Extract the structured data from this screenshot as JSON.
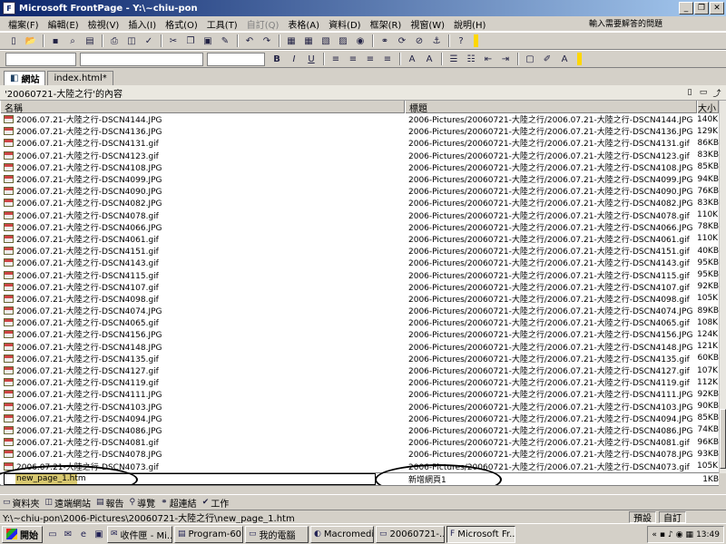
{
  "window": {
    "title": "Microsoft FrontPage - Y:\\~chiu-pon"
  },
  "menu": {
    "items": [
      "檔案(F)",
      "編輯(E)",
      "檢視(V)",
      "插入(I)",
      "格式(O)",
      "工具(T)",
      "自訂(Q)",
      "表格(A)",
      "資料(D)",
      "框架(R)",
      "視窗(W)",
      "說明(H)"
    ],
    "help_placeholder": "輸入需要解答的問題"
  },
  "tabs": [
    {
      "label": "網站"
    },
    {
      "label": "index.html*"
    }
  ],
  "folder": {
    "caption": "'20060721-大陸之行'的內容"
  },
  "columns": {
    "name": "名稱",
    "title": "標題",
    "size": "大小"
  },
  "files": [
    {
      "name": "2006.07.21-大陸之行-DSCN4144.JPG",
      "title": "2006-Pictures/20060721-大陸之行/2006.07.21-大陸之行-DSCN4144.JPG",
      "size": "140KB"
    },
    {
      "name": "2006.07.21-大陸之行-DSCN4136.JPG",
      "title": "2006-Pictures/20060721-大陸之行/2006.07.21-大陸之行-DSCN4136.JPG",
      "size": "129KB"
    },
    {
      "name": "2006.07.21-大陸之行-DSCN4131.gif",
      "title": "2006-Pictures/20060721-大陸之行/2006.07.21-大陸之行-DSCN4131.gif",
      "size": "86KB"
    },
    {
      "name": "2006.07.21-大陸之行-DSCN4123.gif",
      "title": "2006-Pictures/20060721-大陸之行/2006.07.21-大陸之行-DSCN4123.gif",
      "size": "83KB"
    },
    {
      "name": "2006.07.21-大陸之行-DSCN4108.JPG",
      "title": "2006-Pictures/20060721-大陸之行/2006.07.21-大陸之行-DSCN4108.JPG",
      "size": "85KB"
    },
    {
      "name": "2006.07.21-大陸之行-DSCN4099.JPG",
      "title": "2006-Pictures/20060721-大陸之行/2006.07.21-大陸之行-DSCN4099.JPG",
      "size": "94KB"
    },
    {
      "name": "2006.07.21-大陸之行-DSCN4090.JPG",
      "title": "2006-Pictures/20060721-大陸之行/2006.07.21-大陸之行-DSCN4090.JPG",
      "size": "76KB"
    },
    {
      "name": "2006.07.21-大陸之行-DSCN4082.JPG",
      "title": "2006-Pictures/20060721-大陸之行/2006.07.21-大陸之行-DSCN4082.JPG",
      "size": "83KB"
    },
    {
      "name": "2006.07.21-大陸之行-DSCN4078.gif",
      "title": "2006-Pictures/20060721-大陸之行/2006.07.21-大陸之行-DSCN4078.gif",
      "size": "110KB"
    },
    {
      "name": "2006.07.21-大陸之行-DSCN4066.JPG",
      "title": "2006-Pictures/20060721-大陸之行/2006.07.21-大陸之行-DSCN4066.JPG",
      "size": "78KB"
    },
    {
      "name": "2006.07.21-大陸之行-DSCN4061.gif",
      "title": "2006-Pictures/20060721-大陸之行/2006.07.21-大陸之行-DSCN4061.gif",
      "size": "110KB"
    },
    {
      "name": "2006.07.21-大陸之行-DSCN4151.gif",
      "title": "2006-Pictures/20060721-大陸之行/2006.07.21-大陸之行-DSCN4151.gif",
      "size": "40KB"
    },
    {
      "name": "2006.07.21-大陸之行-DSCN4143.gif",
      "title": "2006-Pictures/20060721-大陸之行/2006.07.21-大陸之行-DSCN4143.gif",
      "size": "95KB"
    },
    {
      "name": "2006.07.21-大陸之行-DSCN4115.gif",
      "title": "2006-Pictures/20060721-大陸之行/2006.07.21-大陸之行-DSCN4115.gif",
      "size": "95KB"
    },
    {
      "name": "2006.07.21-大陸之行-DSCN4107.gif",
      "title": "2006-Pictures/20060721-大陸之行/2006.07.21-大陸之行-DSCN4107.gif",
      "size": "92KB"
    },
    {
      "name": "2006.07.21-大陸之行-DSCN4098.gif",
      "title": "2006-Pictures/20060721-大陸之行/2006.07.21-大陸之行-DSCN4098.gif",
      "size": "105KB"
    },
    {
      "name": "2006.07.21-大陸之行-DSCN4074.JPG",
      "title": "2006-Pictures/20060721-大陸之行/2006.07.21-大陸之行-DSCN4074.JPG",
      "size": "89KB"
    },
    {
      "name": "2006.07.21-大陸之行-DSCN4065.gif",
      "title": "2006-Pictures/20060721-大陸之行/2006.07.21-大陸之行-DSCN4065.gif",
      "size": "108KB"
    },
    {
      "name": "2006.07.21-大陸之行-DSCN4156.JPG",
      "title": "2006-Pictures/20060721-大陸之行/2006.07.21-大陸之行-DSCN4156.JPG",
      "size": "124KB"
    },
    {
      "name": "2006.07.21-大陸之行-DSCN4148.JPG",
      "title": "2006-Pictures/20060721-大陸之行/2006.07.21-大陸之行-DSCN4148.JPG",
      "size": "121KB"
    },
    {
      "name": "2006.07.21-大陸之行-DSCN4135.gif",
      "title": "2006-Pictures/20060721-大陸之行/2006.07.21-大陸之行-DSCN4135.gif",
      "size": "60KB"
    },
    {
      "name": "2006.07.21-大陸之行-DSCN4127.gif",
      "title": "2006-Pictures/20060721-大陸之行/2006.07.21-大陸之行-DSCN4127.gif",
      "size": "107KB"
    },
    {
      "name": "2006.07.21-大陸之行-DSCN4119.gif",
      "title": "2006-Pictures/20060721-大陸之行/2006.07.21-大陸之行-DSCN4119.gif",
      "size": "112KB"
    },
    {
      "name": "2006.07.21-大陸之行-DSCN4111.JPG",
      "title": "2006-Pictures/20060721-大陸之行/2006.07.21-大陸之行-DSCN4111.JPG",
      "size": "92KB"
    },
    {
      "name": "2006.07.21-大陸之行-DSCN4103.JPG",
      "title": "2006-Pictures/20060721-大陸之行/2006.07.21-大陸之行-DSCN4103.JPG",
      "size": "90KB"
    },
    {
      "name": "2006.07.21-大陸之行-DSCN4094.JPG",
      "title": "2006-Pictures/20060721-大陸之行/2006.07.21-大陸之行-DSCN4094.JPG",
      "size": "85KB"
    },
    {
      "name": "2006.07.21-大陸之行-DSCN4086.JPG",
      "title": "2006-Pictures/20060721-大陸之行/2006.07.21-大陸之行-DSCN4086.JPG",
      "size": "74KB"
    },
    {
      "name": "2006.07.21-大陸之行-DSCN4081.gif",
      "title": "2006-Pictures/20060721-大陸之行/2006.07.21-大陸之行-DSCN4081.gif",
      "size": "96KB"
    },
    {
      "name": "2006.07.21-大陸之行-DSCN4078.JPG",
      "title": "2006-Pictures/20060721-大陸之行/2006.07.21-大陸之行-DSCN4078.JPG",
      "size": "93KB"
    },
    {
      "name": "2006.07.21-大陸之行-DSCN4073.gif",
      "title": "2006-Pictures/20060721-大陸之行/2006.07.21-大陸之行-DSCN4073.gif",
      "size": "105KB"
    }
  ],
  "new_item": {
    "name": "new_page_1.htm",
    "title": "新增網頁1",
    "size": "1KB"
  },
  "views": [
    {
      "label": "資料夾",
      "icon": "folder-icon"
    },
    {
      "label": "遠端網站",
      "icon": "remote-site-icon"
    },
    {
      "label": "報告",
      "icon": "report-icon"
    },
    {
      "label": "導覽",
      "icon": "navigation-icon"
    },
    {
      "label": "超連結",
      "icon": "hyperlink-icon"
    },
    {
      "label": "工作",
      "icon": "tasks-icon"
    }
  ],
  "status": {
    "path": "Y:\\~chiu-pon\\2006-Pictures\\20060721-大陸之行\\new_page_1.htm",
    "mode_default": "預設",
    "mode_custom": "自訂"
  },
  "taskbar": {
    "start_label": "開始",
    "buttons": [
      "收件匣 - Mi...",
      "Program-60...",
      "我的電腦",
      "Macromedia...",
      "20060721-...",
      "Microsoft Fr..."
    ],
    "clock": "13:49"
  }
}
